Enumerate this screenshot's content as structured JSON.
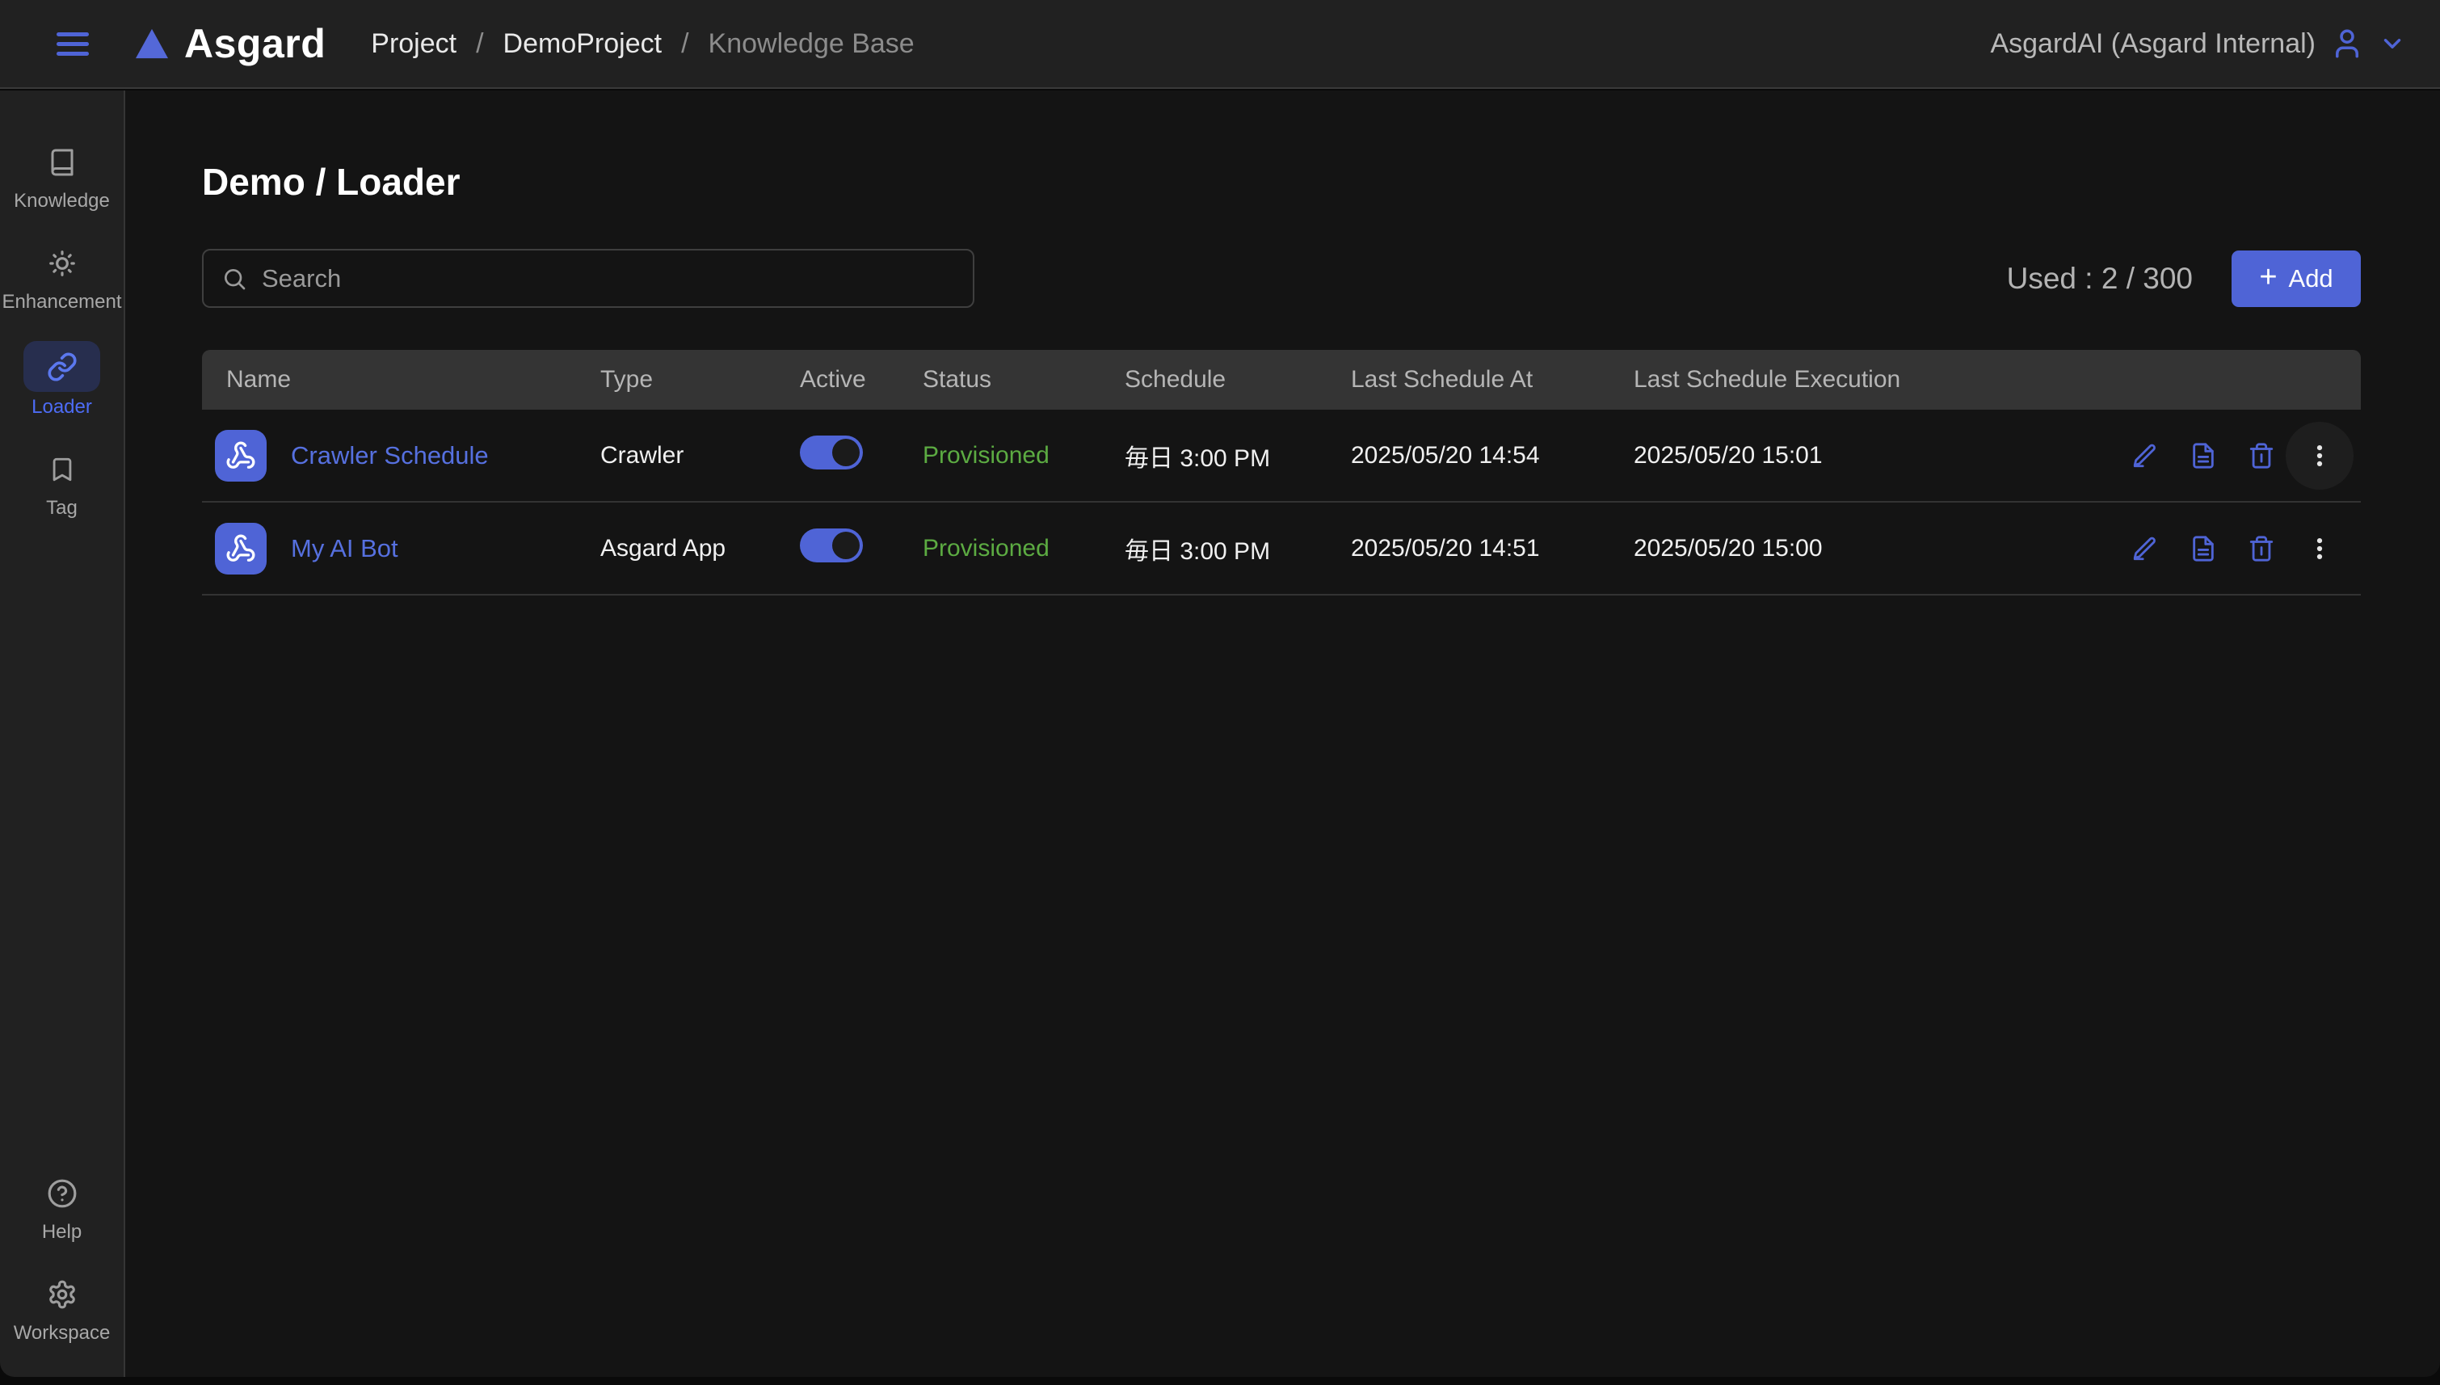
{
  "topbar": {
    "brand": "Asgard",
    "breadcrumb": [
      {
        "label": "Project"
      },
      {
        "label": "DemoProject"
      },
      {
        "label": "Knowledge Base"
      }
    ],
    "separator": "/",
    "account": "AsgardAI (Asgard Internal)"
  },
  "sidebar": {
    "items": [
      {
        "label": "Knowledge",
        "icon": "book-icon",
        "active": false
      },
      {
        "label": "Enhancement",
        "icon": "sun-icon",
        "active": false
      },
      {
        "label": "Loader",
        "icon": "link-icon",
        "active": true
      },
      {
        "label": "Tag",
        "icon": "bookmark-icon",
        "active": false
      }
    ],
    "bottom_items": [
      {
        "label": "Help",
        "icon": "help-circle-icon"
      },
      {
        "label": "Workspace",
        "icon": "gear-icon"
      }
    ]
  },
  "main": {
    "title": "Demo / Loader",
    "search_placeholder": "Search",
    "usage": "Used : 2 / 300",
    "add_label": "Add",
    "add_plus": "+"
  },
  "table": {
    "columns": [
      "Name",
      "Type",
      "Active",
      "Status",
      "Schedule",
      "Last Schedule At",
      "Last Schedule Execution"
    ],
    "row_actions": [
      "edit",
      "document",
      "delete",
      "more"
    ],
    "rows": [
      {
        "name": "Crawler Schedule",
        "type": "Crawler",
        "active": true,
        "status": "Provisioned",
        "schedule": "毎日 3:00 PM",
        "last_schedule_at": "2025/05/20 14:54",
        "last_schedule_execution": "2025/05/20 15:01"
      },
      {
        "name": "My AI Bot",
        "type": "Asgard App",
        "active": true,
        "status": "Provisioned",
        "schedule": "毎日 3:00 PM",
        "last_schedule_at": "2025/05/20 14:51",
        "last_schedule_execution": "2025/05/20 15:00"
      }
    ]
  },
  "colors": {
    "accent_blue": "#4f64d6",
    "link_blue": "#5670df",
    "status_green": "#5cab42",
    "topbar_bg": "#212121",
    "content_bg": "#141414",
    "table_header_bg": "#343434",
    "active_pill_bg": "#272e4e"
  }
}
